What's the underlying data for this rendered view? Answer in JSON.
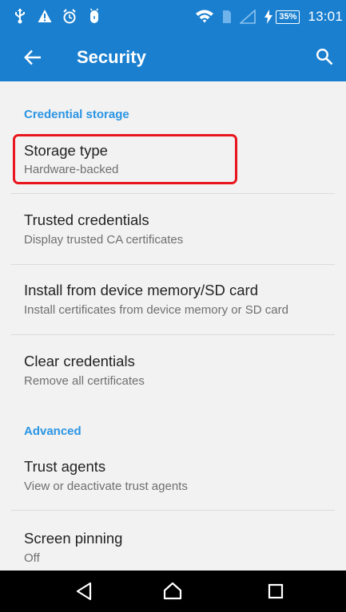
{
  "status_bar": {
    "left_icons": [
      "usb-icon",
      "warning-icon",
      "alarm-icon",
      "android-debug-icon"
    ],
    "right_icons": [
      "wifi-icon",
      "sim-icon",
      "signal-icon",
      "charging-icon"
    ],
    "battery_level": "35%",
    "time": "13:01",
    "background": "#1a7fcf"
  },
  "app_bar": {
    "title": "Security",
    "back_icon": "arrow-back-icon",
    "search_icon": "search-icon"
  },
  "sections": {
    "credential_storage": {
      "header": "Credential storage",
      "items": [
        {
          "title": "Storage type",
          "summary": "Hardware-backed"
        },
        {
          "title": "Trusted credentials",
          "summary": "Display trusted CA certificates"
        },
        {
          "title": "Install from device memory/SD card",
          "summary": "Install certificates from device memory or SD card"
        },
        {
          "title": "Clear credentials",
          "summary": "Remove all certificates"
        }
      ]
    },
    "advanced": {
      "header": "Advanced",
      "items": [
        {
          "title": "Trust agents",
          "summary": "View or deactivate trust agents"
        },
        {
          "title": "Screen pinning",
          "summary": "Off"
        }
      ]
    }
  },
  "highlight": {
    "target": "Storage type",
    "color": "#e8151d"
  },
  "nav_bar": {
    "buttons": [
      "back-triangle-icon",
      "home-icon",
      "recents-square-icon"
    ]
  },
  "colors": {
    "accent": "#2a95e4",
    "toolbar": "#1a7fcf",
    "background": "#f2f2f2"
  }
}
